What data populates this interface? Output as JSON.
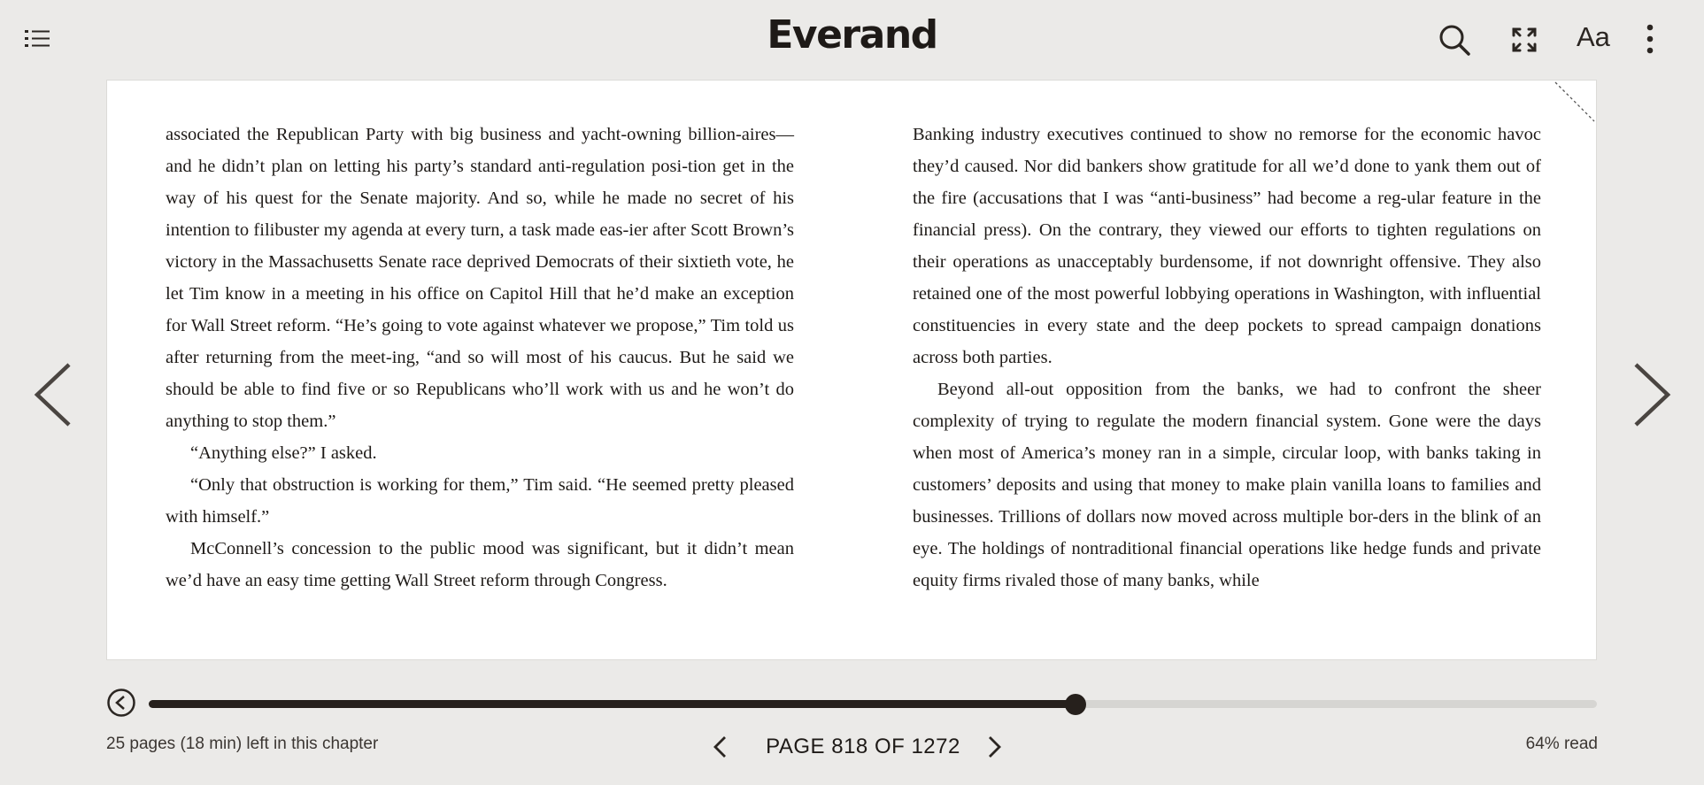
{
  "app": {
    "logo_text": "Everand"
  },
  "toolbar": {
    "left_icon": "table-of-contents-icon",
    "right_icons": [
      "search-icon",
      "fullscreen-icon",
      "text-settings-icon",
      "more-options-icon"
    ],
    "text_settings_label": "Aa"
  },
  "reader": {
    "left_column": [
      "associated the Republican Party with big business and yacht-owning billion-aires—and he didn’t plan on letting his party’s standard anti-regulation posi-tion get in the way of his quest for the Senate majority. And so, while he made no secret of his intention to filibuster my agenda at every turn, a task made eas-ier after Scott Brown’s victory in the Massachusetts Senate race deprived Democrats of their sixtieth vote, he let Tim know in a meeting in his office on Capitol Hill that he’d make an exception for Wall Street reform. “He’s going to vote against whatever we propose,” Tim told us after returning from the meet-ing, “and so will most of his caucus. But he said we should be able to find five or so Republicans who’ll work with us and he won’t do anything to stop them.”",
      "“Anything else?” I asked.",
      "“Only that obstruction is working for them,” Tim said. “He seemed pretty pleased with himself.”",
      "McConnell’s concession to the public mood was significant, but it didn’t mean we’d have an easy time getting Wall Street reform through Congress."
    ],
    "right_column": [
      "Banking industry executives continued to show no remorse for the economic havoc they’d caused. Nor did bankers show gratitude for all we’d done to yank them out of the fire (accusations that I was “anti-business” had become a reg-ular feature in the financial press). On the contrary, they viewed our efforts to tighten regulations on their operations as unacceptably burdensome, if not downright offensive. They also retained one of the most powerful lobbying operations in Washington, with influential constituencies in every state and the deep pockets to spread campaign donations across both parties.",
      "Beyond all-out opposition from the banks, we had to confront the sheer complexity of trying to regulate the modern financial system. Gone were the days when most of America’s money ran in a simple, circular loop, with banks taking in customers’ deposits and using that money to make plain vanilla loans to families and businesses. Trillions of dollars now moved across multiple bor-ders in the blink of an eye. The holdings of nontraditional financial operations like hedge funds and private equity firms rivaled those of many banks, while"
    ]
  },
  "footer": {
    "progress_fraction": 0.64,
    "chapter_remaining": "25 pages (18 min) left in this chapter",
    "page_label": "PAGE 818 OF 1272",
    "percent_read": "64% read"
  },
  "colors": {
    "background": "#ebeae8",
    "page": "#ffffff",
    "ink": "#1e1a17",
    "progress_fill": "#26201c",
    "progress_track": "#d6d5d2"
  }
}
